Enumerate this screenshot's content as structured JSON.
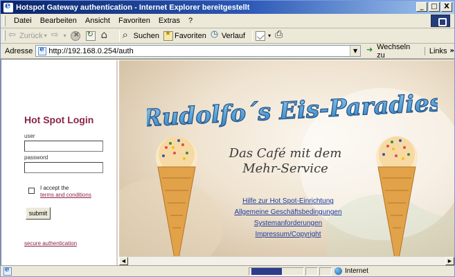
{
  "window": {
    "title": "Hotspot Gateway authentication - Internet Explorer bereitgestellt",
    "buttons": [
      "_",
      "□",
      "X"
    ]
  },
  "menubar": {
    "items": [
      {
        "label": "Datei"
      },
      {
        "label": "Bearbeiten"
      },
      {
        "label": "Ansicht"
      },
      {
        "label": "Favoriten"
      },
      {
        "label": "Extras"
      },
      {
        "label": "?"
      }
    ]
  },
  "toolbar": {
    "back_label": "Zurück",
    "search_label": "Suchen",
    "favorites_label": "Favoriten",
    "history_label": "Verlauf"
  },
  "addressbar": {
    "label": "Adresse",
    "url": "http://192.168.0.254/auth",
    "go_label": "Wechseln zu",
    "links_label": "Links"
  },
  "login": {
    "title": "Hot Spot Login",
    "user_label": "user",
    "password_label": "password",
    "accept_text": "I accept the",
    "terms_link": "terms and conditions",
    "submit_label": "submit",
    "secure_link": "secure authentication"
  },
  "banner": {
    "title": "Rudolfo´s Eis-Paradies",
    "tagline_line1": "Das Café mit dem",
    "tagline_line2": "Mehr-Service"
  },
  "nav_links": [
    {
      "label": "Hilfe zur Hot Spot-Einrichtung"
    },
    {
      "label": "Allgemeine Geschäftsbedingungen"
    },
    {
      "label": "Systemanforderungen"
    },
    {
      "label": "Impressum/Copyright"
    }
  ],
  "statusbar": {
    "zone_label": "Internet"
  },
  "colors": {
    "title_gradient_start": "#0a246a",
    "login_title": "#8b2346",
    "link_blue": "#1b3a9a",
    "banner_blue": "#4a9ad4"
  }
}
